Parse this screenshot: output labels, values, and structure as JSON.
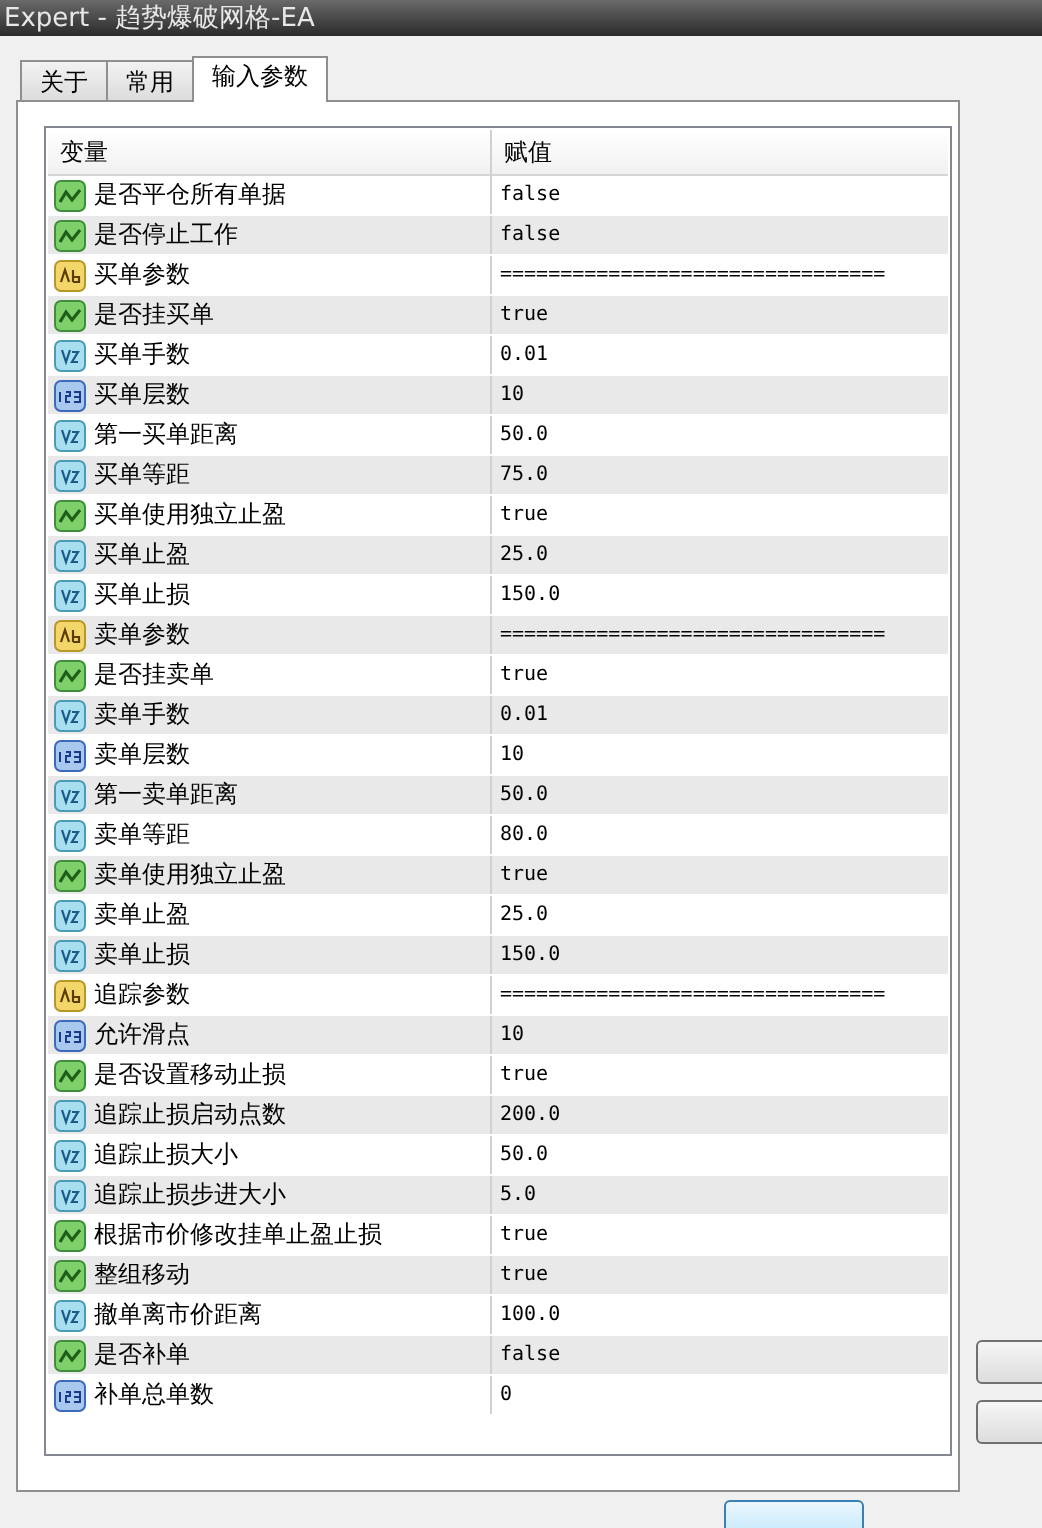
{
  "window": {
    "title": "Expert - 趋势爆破网格-EA"
  },
  "tabs": [
    {
      "label": "关于",
      "selected": false
    },
    {
      "label": "常用",
      "selected": false
    },
    {
      "label": "输入参数",
      "selected": true
    }
  ],
  "table": {
    "columns": [
      "变量",
      "赋值"
    ],
    "rows": [
      {
        "kind": "bool",
        "name": "是否平仓所有单据",
        "value": "false"
      },
      {
        "kind": "bool",
        "name": "是否停止工作",
        "value": "false"
      },
      {
        "kind": "string",
        "name": "买单参数",
        "value": "================================"
      },
      {
        "kind": "bool",
        "name": "是否挂买单",
        "value": "true"
      },
      {
        "kind": "double",
        "name": "买单手数",
        "value": "0.01"
      },
      {
        "kind": "int",
        "name": "买单层数",
        "value": "10"
      },
      {
        "kind": "double",
        "name": "第一买单距离",
        "value": "50.0"
      },
      {
        "kind": "double",
        "name": "买单等距",
        "value": "75.0"
      },
      {
        "kind": "bool",
        "name": "买单使用独立止盈",
        "value": "true"
      },
      {
        "kind": "double",
        "name": "买单止盈",
        "value": "25.0"
      },
      {
        "kind": "double",
        "name": "买单止损",
        "value": "150.0"
      },
      {
        "kind": "string",
        "name": "卖单参数",
        "value": "================================"
      },
      {
        "kind": "bool",
        "name": "是否挂卖单",
        "value": "true"
      },
      {
        "kind": "double",
        "name": "卖单手数",
        "value": "0.01"
      },
      {
        "kind": "int",
        "name": "卖单层数",
        "value": "10"
      },
      {
        "kind": "double",
        "name": "第一卖单距离",
        "value": "50.0"
      },
      {
        "kind": "double",
        "name": "卖单等距",
        "value": "80.0"
      },
      {
        "kind": "bool",
        "name": "卖单使用独立止盈",
        "value": "true"
      },
      {
        "kind": "double",
        "name": "卖单止盈",
        "value": "25.0"
      },
      {
        "kind": "double",
        "name": "卖单止损",
        "value": "150.0"
      },
      {
        "kind": "string",
        "name": "追踪参数",
        "value": "================================"
      },
      {
        "kind": "int",
        "name": "允许滑点",
        "value": "10"
      },
      {
        "kind": "bool",
        "name": "是否设置移动止损",
        "value": "true"
      },
      {
        "kind": "double",
        "name": "追踪止损启动点数",
        "value": "200.0"
      },
      {
        "kind": "double",
        "name": "追踪止损大小",
        "value": "50.0"
      },
      {
        "kind": "double",
        "name": "追踪止损步进大小",
        "value": "5.0"
      },
      {
        "kind": "bool",
        "name": "根据市价修改挂单止盈止损",
        "value": "true"
      },
      {
        "kind": "bool",
        "name": "整组移动",
        "value": "true"
      },
      {
        "kind": "double",
        "name": "撤单离市价距离",
        "value": "100.0"
      },
      {
        "kind": "bool",
        "name": "是否补单",
        "value": "false"
      },
      {
        "kind": "int",
        "name": "补单总单数",
        "value": "0"
      }
    ]
  }
}
